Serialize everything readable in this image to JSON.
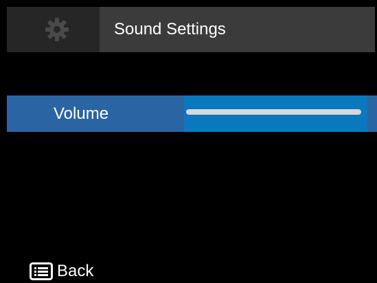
{
  "header": {
    "icon": "gear-icon",
    "title": "Sound Settings"
  },
  "settings": {
    "volume": {
      "label": "Volume",
      "level": 1.0
    }
  },
  "footer": {
    "icon": "menu-list-icon",
    "back_label": "Back"
  },
  "colors": {
    "background": "#000000",
    "header_icon_bg": "#262626",
    "header_title_bg": "#3b3b3b",
    "selected_row": "#2a64a3",
    "slider_bg": "#0a78bf",
    "slider_fill": "#d8d8d8"
  }
}
